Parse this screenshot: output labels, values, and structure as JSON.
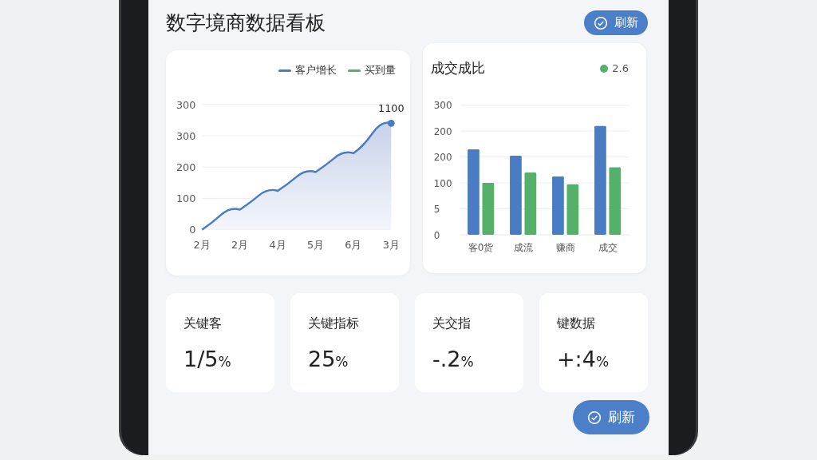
{
  "header": {
    "title": "数字境商数据看板",
    "refresh_button": "刷新"
  },
  "growth_card": {
    "legend": [
      {
        "label": "客户增长",
        "color": "#4a7cc4"
      },
      {
        "label": "买到量",
        "color": "#55b06a"
      }
    ],
    "y_labels": [
      "300",
      "300",
      "200",
      "100",
      "0"
    ],
    "x_labels": [
      "2月",
      "2月",
      "4月",
      "5月",
      "6月",
      "3月"
    ],
    "point_label": "1100"
  },
  "ratio_card": {
    "title": "成交成比",
    "legend": [
      {
        "label": "2.6",
        "color": "#55b06a"
      }
    ],
    "y_labels": [
      "300",
      "200",
      "200",
      "100",
      "5",
      "0"
    ],
    "x_labels": [
      "客0货",
      "成流",
      "赚商",
      "成交"
    ]
  },
  "kpis": [
    {
      "label": "关键客",
      "value": "1/5",
      "unit": "%"
    },
    {
      "label": "关键指标",
      "value": "25",
      "unit": "%"
    },
    {
      "label": "关交指",
      "value": "-.2",
      "unit": "%"
    },
    {
      "label": "键数据",
      "value": "+:4",
      "unit": "%"
    }
  ],
  "footer": {
    "refresh_button": "刷新"
  }
}
